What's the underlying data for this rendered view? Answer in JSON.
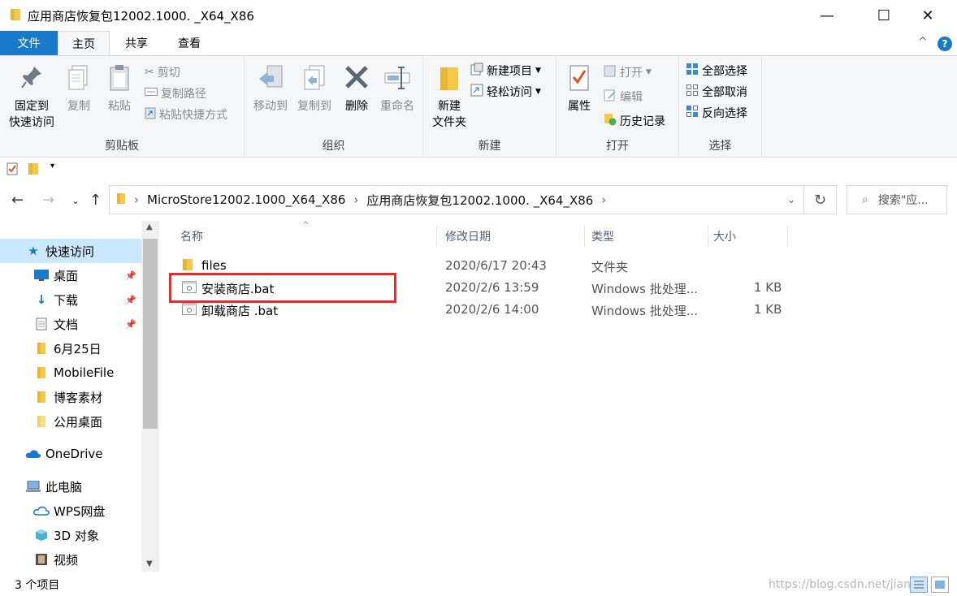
{
  "window": {
    "title": "应用商店恢复包12002.1000. _X64_X86",
    "controls": {
      "minimize": "—",
      "maximize": "☐",
      "close": "✕"
    }
  },
  "ribbon_tabs": {
    "file": "文件",
    "home": "主页",
    "share": "共享",
    "view": "查看",
    "collapse": "^",
    "help": "?"
  },
  "ribbon": {
    "clipboard": {
      "label": "剪贴板",
      "pin": [
        "固定到",
        "快速访问"
      ],
      "copy": "复制",
      "paste": "粘贴",
      "cut": "剪切",
      "copy_path": "复制路径",
      "paste_shortcut": "粘贴快捷方式"
    },
    "organize": {
      "label": "组织",
      "move_to": "移动到",
      "copy_to": "复制到",
      "delete": "删除",
      "rename": "重命名"
    },
    "new": {
      "label": "新建",
      "new_folder": [
        "新建",
        "文件夹"
      ],
      "new_item": "新建项目",
      "easy_access": "轻松访问"
    },
    "open": {
      "label": "打开",
      "properties": "属性",
      "open": "打开",
      "edit": "编辑",
      "history": "历史记录"
    },
    "select": {
      "label": "选择",
      "select_all": "全部选择",
      "select_none": "全部取消",
      "invert": "反向选择"
    }
  },
  "address": {
    "segments": [
      "MicroStore12002.1000_X64_X86",
      "应用商店恢复包12002.1000. _X64_X86"
    ],
    "search_placeholder": "搜索\"应..."
  },
  "nav": {
    "quick_access": "快速访问",
    "items": [
      {
        "label": "桌面",
        "pinned": true
      },
      {
        "label": "下载",
        "pinned": true
      },
      {
        "label": "文档",
        "pinned": true
      },
      {
        "label": "6月25日",
        "pinned": false
      },
      {
        "label": "MobileFile",
        "pinned": false
      },
      {
        "label": "博客素材",
        "pinned": false
      },
      {
        "label": "公用桌面",
        "pinned": false
      }
    ],
    "onedrive": "OneDrive",
    "this_pc": "此电脑",
    "pc_items": [
      "WPS网盘",
      "3D 对象",
      "视频"
    ]
  },
  "columns": {
    "name": "名称",
    "date": "修改日期",
    "type": "类型",
    "size": "大小"
  },
  "files": [
    {
      "name": "files",
      "date": "2020/6/17 20:43",
      "type": "文件夹",
      "size": "",
      "kind": "folder"
    },
    {
      "name": "安装商店.bat",
      "date": "2020/2/6 13:59",
      "type": "Windows 批处理...",
      "size": "1 KB",
      "kind": "bat"
    },
    {
      "name": "卸载商店 .bat",
      "date": "2020/2/6 14:00",
      "type": "Windows 批处理...",
      "size": "1 KB",
      "kind": "bat"
    }
  ],
  "status": {
    "count": "3 个项目",
    "watermark": "https://blog.csdn.net/jianli"
  },
  "colors": {
    "accent": "#1979ca",
    "highlight_box": "#e82b2b",
    "selected": "#cce8ff",
    "folder": "#f7c948"
  }
}
